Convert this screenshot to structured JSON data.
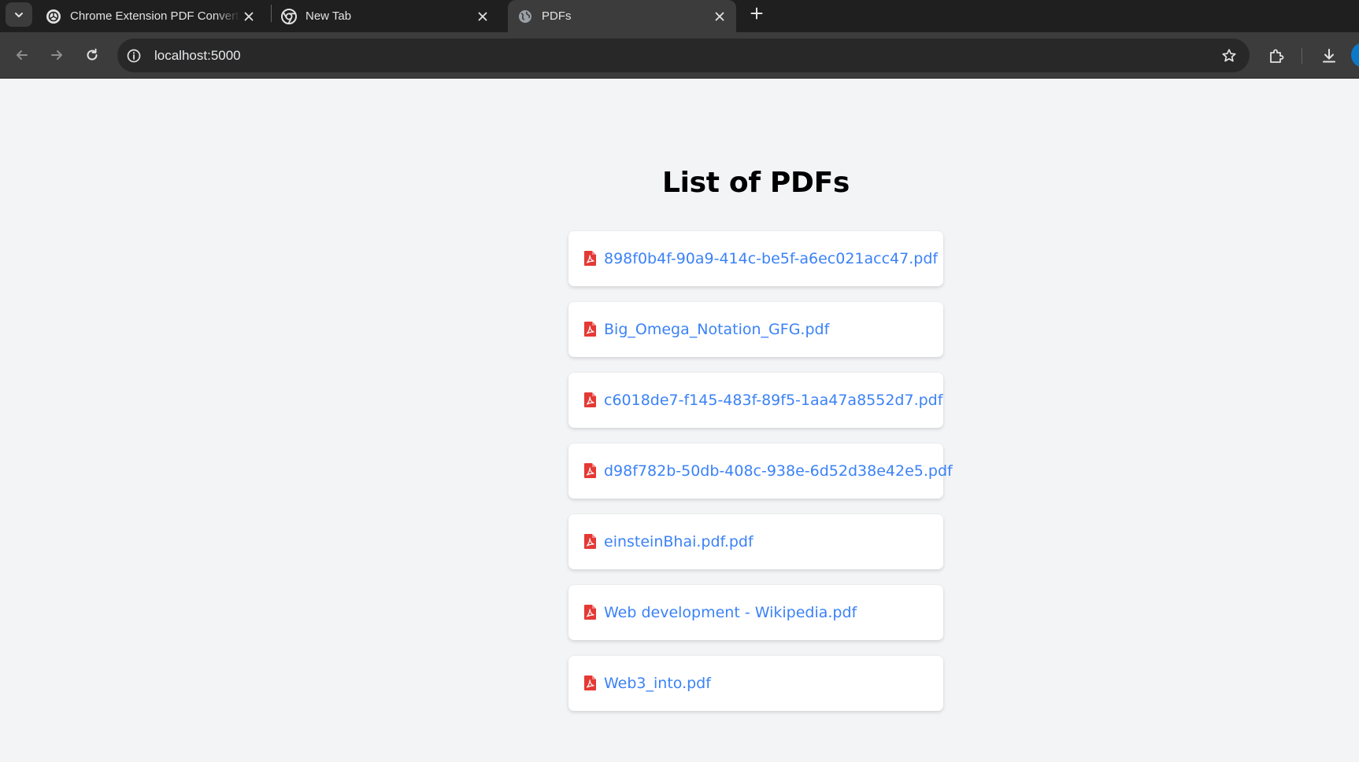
{
  "browser": {
    "tabs": [
      {
        "title": "Chrome Extension PDF Converter",
        "favicon": "openai-icon",
        "active": false
      },
      {
        "title": "New Tab",
        "favicon": "chrome-icon",
        "active": false
      },
      {
        "title": "PDFs",
        "favicon": "globe-icon",
        "active": true
      }
    ],
    "address": "localhost:5000"
  },
  "page": {
    "title": "List of PDFs",
    "pdfs": [
      "898f0b4f-90a9-414c-be5f-a6ec021acc47.pdf",
      "Big_Omega_Notation_GFG.pdf",
      "c6018de7-f145-483f-89f5-1aa47a8552d7.pdf",
      "d98f782b-50db-408c-938e-6d52d38e42e5.pdf",
      "einsteinBhai.pdf.pdf",
      "Web development - Wikipedia.pdf",
      "Web3_into.pdf"
    ]
  },
  "colors": {
    "link": "#3b82f6",
    "pdf_icon": "#e53935",
    "page_background": "#f3f4f6",
    "toolbar": "#3c3c3c",
    "tabstrip": "#1f1f1f"
  }
}
